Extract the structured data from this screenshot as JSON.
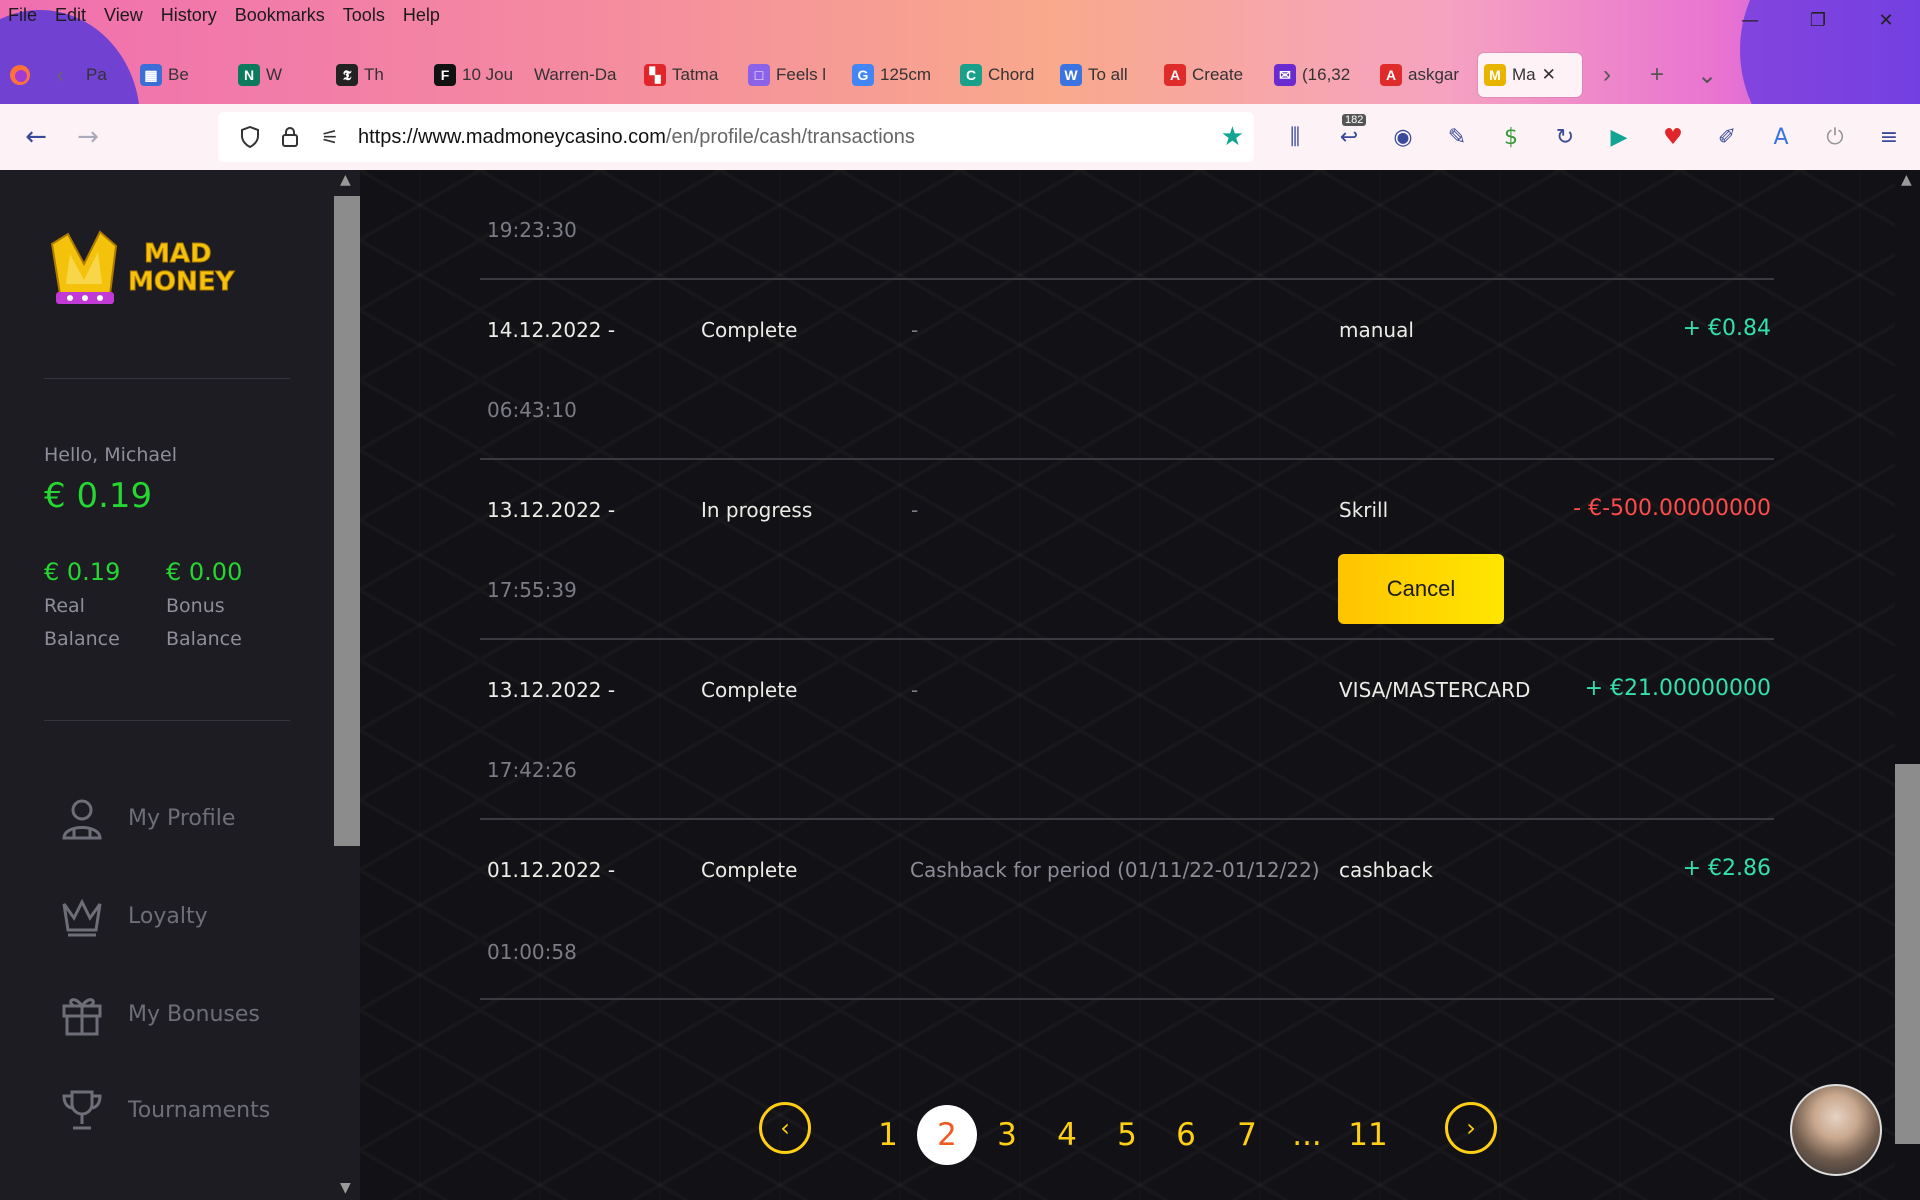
{
  "browser": {
    "menu": [
      "File",
      "Edit",
      "View",
      "History",
      "Bookmarks",
      "Tools",
      "Help"
    ],
    "window_controls": [
      "—",
      "❐",
      "✕"
    ],
    "tabs": [
      {
        "label": "Pa",
        "fav": "",
        "color": "#eaa"
      },
      {
        "label": "Be",
        "fav": "▦",
        "color": "#3b6fd6"
      },
      {
        "label": "W",
        "fav": "N",
        "color": "#0c7a5c"
      },
      {
        "label": "Th",
        "fav": "𝕿",
        "color": "#222"
      },
      {
        "label": "10 Jou",
        "fav": "F",
        "color": "#111"
      },
      {
        "label": "Warren-Da",
        "fav": "",
        "color": "transparent"
      },
      {
        "label": "Tatma",
        "fav": "▚",
        "color": "#e0262b"
      },
      {
        "label": "Feels l",
        "fav": "□",
        "color": "#8b62e8"
      },
      {
        "label": "125cm",
        "fav": "G",
        "color": "#4285f4"
      },
      {
        "label": "Chord",
        "fav": "C",
        "color": "#18a08a"
      },
      {
        "label": "To all",
        "fav": "W",
        "color": "#3b74e0"
      },
      {
        "label": "Create",
        "fav": "A",
        "color": "#e02b2b"
      },
      {
        "label": "(16,32",
        "fav": "✉",
        "color": "#6a2bd0"
      },
      {
        "label": "askgar",
        "fav": "A",
        "color": "#e02b2b"
      },
      {
        "label": "Ma",
        "fav": "M",
        "color": "#e8b400"
      }
    ],
    "url_domain": "https://www.madmoneycasino.com",
    "url_path": "/en/profile/cash/transactions",
    "badge_count": "182"
  },
  "sidebar": {
    "greeting": "Hello, Michael",
    "balance_total": "€ 0.19",
    "real_balance_value": "€ 0.19",
    "real_balance_label": "Real Balance",
    "bonus_balance_value": "€ 0.00",
    "bonus_balance_label": "Bonus Balance",
    "nav": [
      {
        "label": "My Profile",
        "icon": "user-icon"
      },
      {
        "label": "Loyalty",
        "icon": "crown-icon"
      },
      {
        "label": "My Bonuses",
        "icon": "gift-icon"
      },
      {
        "label": "Tournaments",
        "icon": "trophy-icon"
      }
    ],
    "logo_text_1": "MAD",
    "logo_text_2": "MONEY"
  },
  "transactions": {
    "top_time": "19:23:30",
    "rows": [
      {
        "date": "14.12.2022 -",
        "time": "06:43:10",
        "status": "Complete",
        "description": "-",
        "method": "manual",
        "amount": "+ €0.84",
        "type": "pos"
      },
      {
        "date": "13.12.2022 -",
        "time": "17:55:39",
        "status": "In progress",
        "description": "-",
        "method": "Skrill",
        "amount": "- €-500.00000000",
        "type": "neg",
        "action": "Cancel"
      },
      {
        "date": "13.12.2022 -",
        "time": "17:42:26",
        "status": "Complete",
        "description": "-",
        "method": "VISA/MASTERCARD",
        "amount": "+ €21.00000000",
        "type": "pos"
      },
      {
        "date": "01.12.2022 -",
        "time": "01:00:58",
        "status": "Complete",
        "description": "Cashback for period (01/11/22-01/12/22)",
        "method": "cashback",
        "amount": "+ €2.86",
        "type": "pos"
      }
    ]
  },
  "pagination": {
    "pages": [
      "1",
      "2",
      "3",
      "4",
      "5",
      "6",
      "7",
      "...",
      "11"
    ],
    "current": "2"
  }
}
